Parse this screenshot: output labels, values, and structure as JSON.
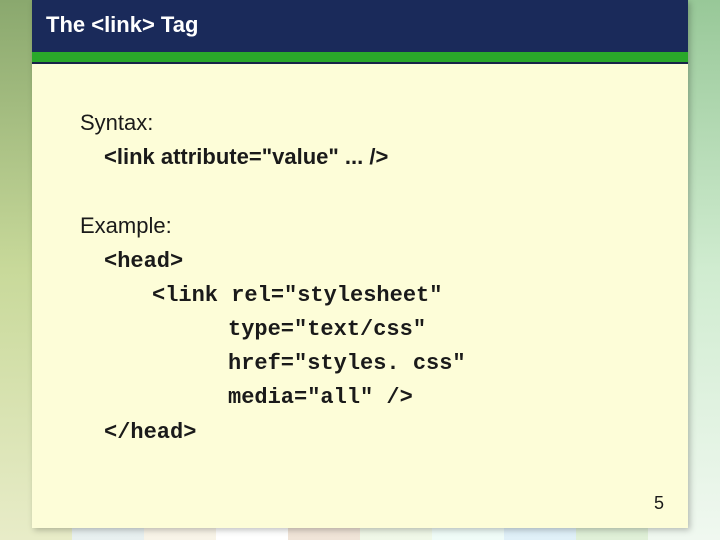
{
  "slide": {
    "title": "The <link> Tag",
    "syntax": {
      "label": "Syntax:",
      "code": "<link attribute=\"value\" ... />"
    },
    "example": {
      "label": "Example:",
      "lines": {
        "l0": "<head>",
        "l1": "<link rel=\"stylesheet\"",
        "l2": "type=\"text/css\"",
        "l3": "href=\"styles. css\"",
        "l4": "media=\"all\" />",
        "l5": "</head>"
      }
    },
    "page_number": "5"
  }
}
